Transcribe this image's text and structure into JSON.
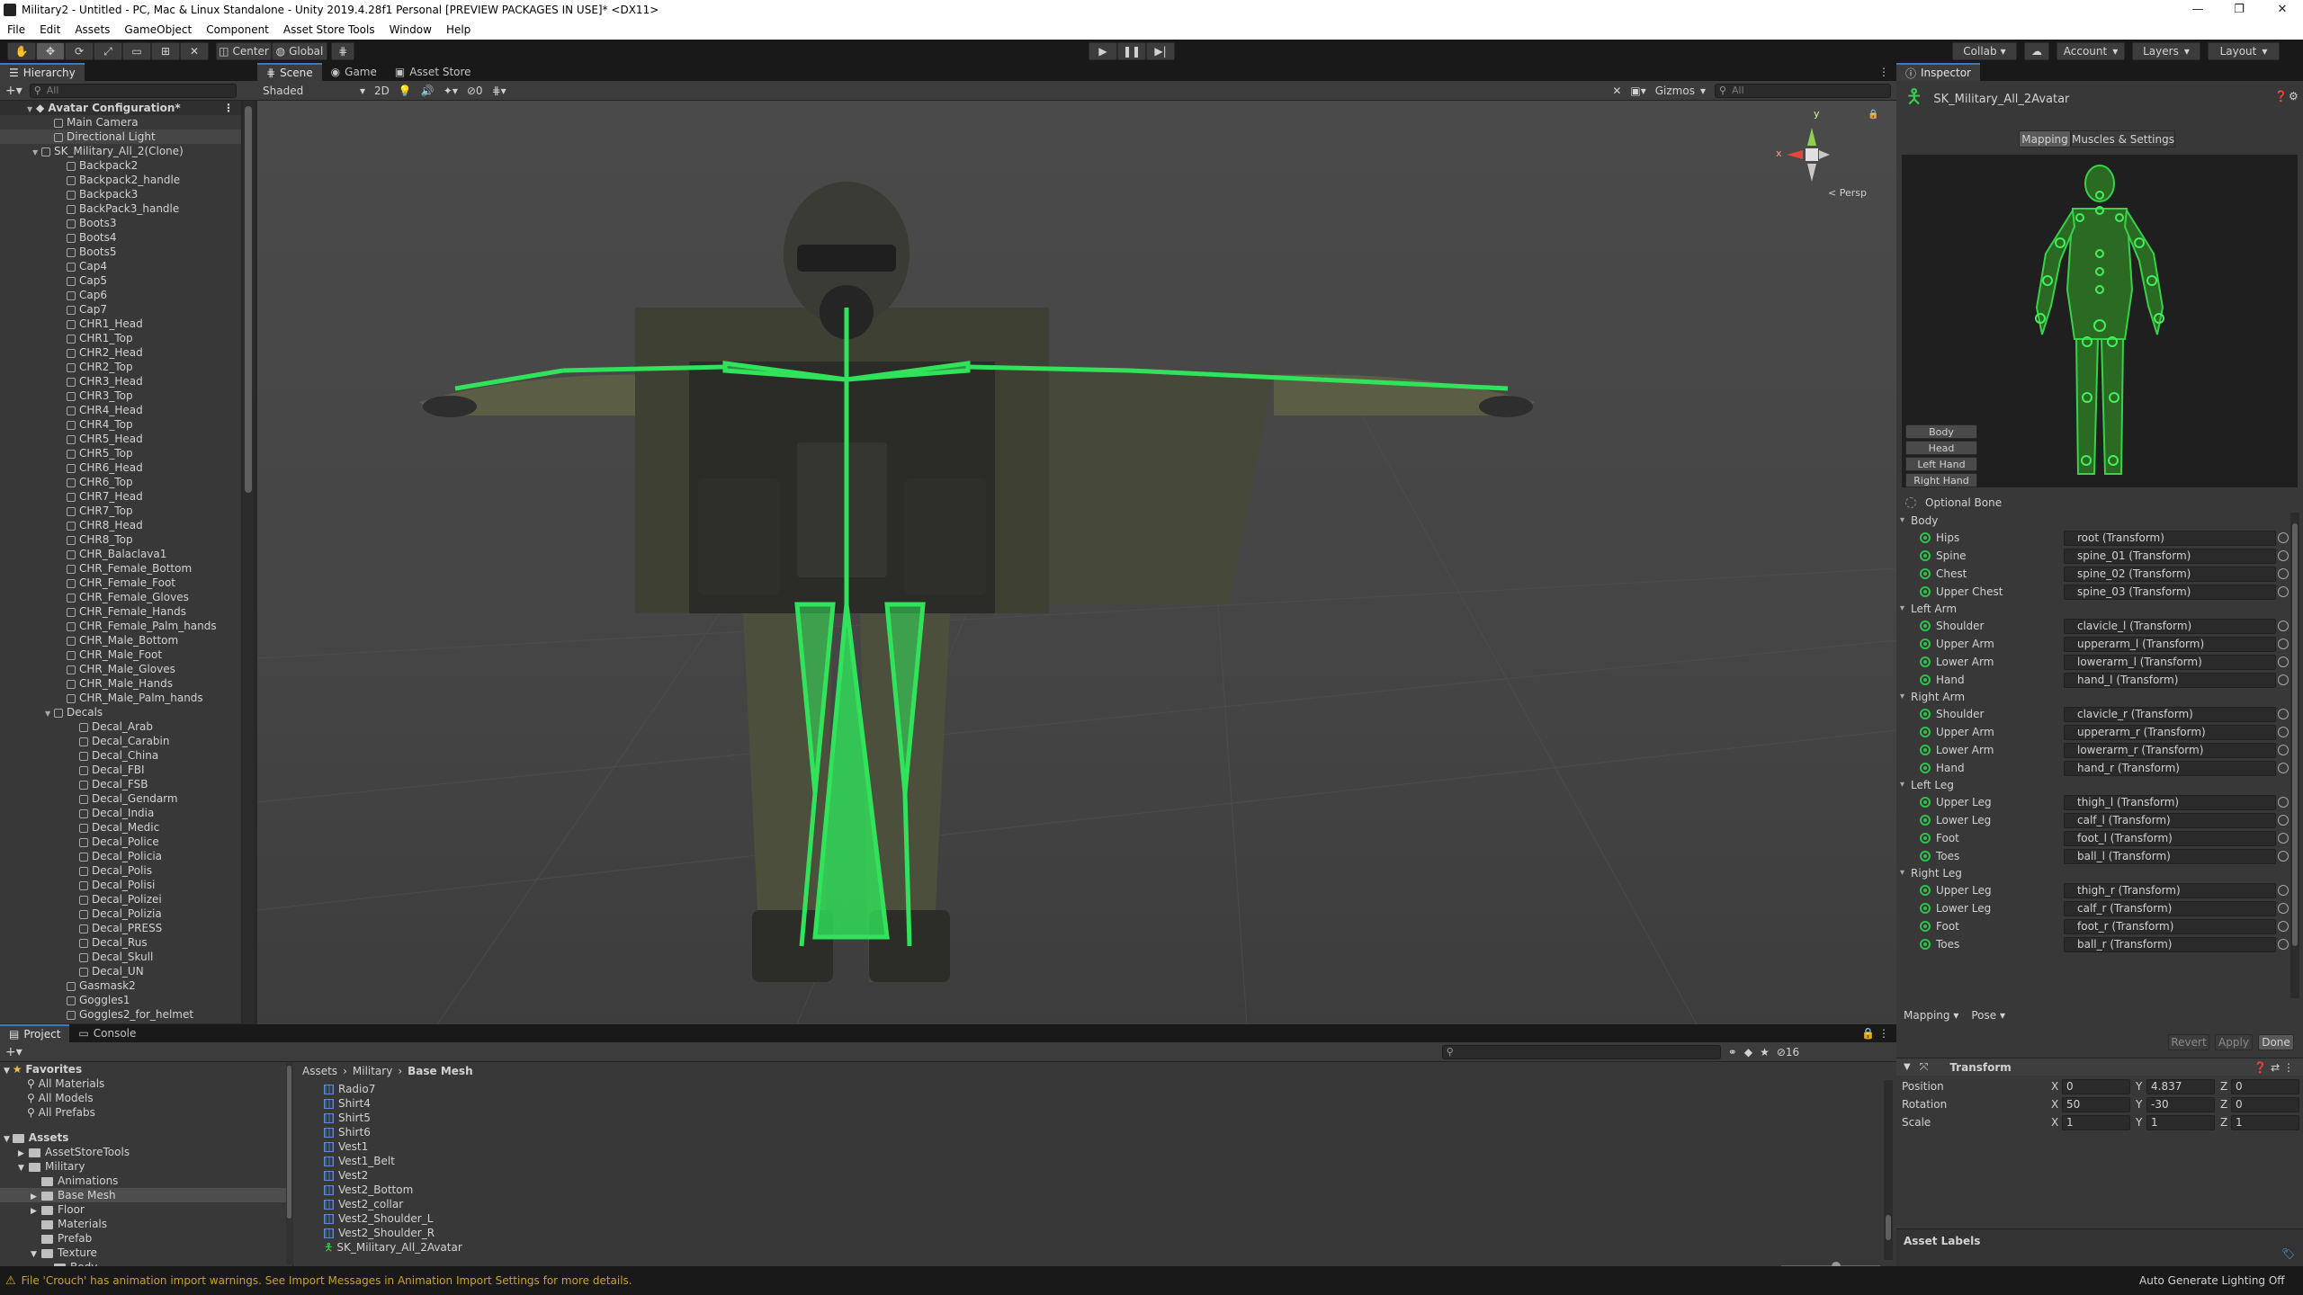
{
  "window": {
    "title": "Military2 - Untitled - PC, Mac & Linux Standalone - Unity 2019.4.28f1 Personal [PREVIEW PACKAGES IN USE]* <DX11>"
  },
  "menu": [
    "File",
    "Edit",
    "Assets",
    "GameObject",
    "Component",
    "Asset Store Tools",
    "Window",
    "Help"
  ],
  "toolbar": {
    "pivot_label": "Center",
    "space_label": "Global",
    "collab_label": "Collab",
    "account_label": "Account",
    "layers_label": "Layers",
    "layout_label": "Layout"
  },
  "hierarchy": {
    "tab": "Hierarchy",
    "search_placeholder": "All",
    "root": "Avatar Configuration*",
    "items": [
      {
        "label": "Main Camera",
        "indent": 3
      },
      {
        "label": "Directional Light",
        "indent": 3
      },
      {
        "label": "SK_Military_All_2(Clone)",
        "indent": 2,
        "arrow": true
      },
      {
        "label": "Backpack2",
        "indent": 4
      },
      {
        "label": "Backpack2_handle",
        "indent": 4
      },
      {
        "label": "Backpack3",
        "indent": 4
      },
      {
        "label": "BackPack3_handle",
        "indent": 4
      },
      {
        "label": "Boots3",
        "indent": 4
      },
      {
        "label": "Boots4",
        "indent": 4
      },
      {
        "label": "Boots5",
        "indent": 4
      },
      {
        "label": "Cap4",
        "indent": 4
      },
      {
        "label": "Cap5",
        "indent": 4
      },
      {
        "label": "Cap6",
        "indent": 4
      },
      {
        "label": "Cap7",
        "indent": 4
      },
      {
        "label": "CHR1_Head",
        "indent": 4
      },
      {
        "label": "CHR1_Top",
        "indent": 4
      },
      {
        "label": "CHR2_Head",
        "indent": 4
      },
      {
        "label": "CHR2_Top",
        "indent": 4
      },
      {
        "label": "CHR3_Head",
        "indent": 4
      },
      {
        "label": "CHR3_Top",
        "indent": 4
      },
      {
        "label": "CHR4_Head",
        "indent": 4
      },
      {
        "label": "CHR4_Top",
        "indent": 4
      },
      {
        "label": "CHR5_Head",
        "indent": 4
      },
      {
        "label": "CHR5_Top",
        "indent": 4
      },
      {
        "label": "CHR6_Head",
        "indent": 4
      },
      {
        "label": "CHR6_Top",
        "indent": 4
      },
      {
        "label": "CHR7_Head",
        "indent": 4
      },
      {
        "label": "CHR7_Top",
        "indent": 4
      },
      {
        "label": "CHR8_Head",
        "indent": 4
      },
      {
        "label": "CHR8_Top",
        "indent": 4
      },
      {
        "label": "CHR_Balaclava1",
        "indent": 4
      },
      {
        "label": "CHR_Female_Bottom",
        "indent": 4
      },
      {
        "label": "CHR_Female_Foot",
        "indent": 4
      },
      {
        "label": "CHR_Female_Gloves",
        "indent": 4
      },
      {
        "label": "CHR_Female_Hands",
        "indent": 4
      },
      {
        "label": "CHR_Female_Palm_hands",
        "indent": 4
      },
      {
        "label": "CHR_Male_Bottom",
        "indent": 4
      },
      {
        "label": "CHR_Male_Foot",
        "indent": 4
      },
      {
        "label": "CHR_Male_Gloves",
        "indent": 4
      },
      {
        "label": "CHR_Male_Hands",
        "indent": 4
      },
      {
        "label": "CHR_Male_Palm_hands",
        "indent": 4
      },
      {
        "label": "Decals",
        "indent": 3,
        "arrow": true
      },
      {
        "label": "Decal_Arab",
        "indent": 5
      },
      {
        "label": "Decal_Carabin",
        "indent": 5
      },
      {
        "label": "Decal_China",
        "indent": 5
      },
      {
        "label": "Decal_FBI",
        "indent": 5
      },
      {
        "label": "Decal_FSB",
        "indent": 5
      },
      {
        "label": "Decal_Gendarm",
        "indent": 5
      },
      {
        "label": "Decal_India",
        "indent": 5
      },
      {
        "label": "Decal_Medic",
        "indent": 5
      },
      {
        "label": "Decal_Police",
        "indent": 5
      },
      {
        "label": "Decal_Policia",
        "indent": 5
      },
      {
        "label": "Decal_Polis",
        "indent": 5
      },
      {
        "label": "Decal_Polisi",
        "indent": 5
      },
      {
        "label": "Decal_Polizei",
        "indent": 5
      },
      {
        "label": "Decal_Polizia",
        "indent": 5
      },
      {
        "label": "Decal_PRESS",
        "indent": 5
      },
      {
        "label": "Decal_Rus",
        "indent": 5
      },
      {
        "label": "Decal_Skull",
        "indent": 5
      },
      {
        "label": "Decal_UN",
        "indent": 5
      },
      {
        "label": "Gasmask2",
        "indent": 4
      },
      {
        "label": "Goggles1",
        "indent": 4
      },
      {
        "label": "Goggles2_for_helmet",
        "indent": 4
      }
    ]
  },
  "scene": {
    "tabs": [
      "Scene",
      "Game",
      "Asset Store"
    ],
    "shading": "Shaded",
    "mode_2d": "2D",
    "hidden_count": "0",
    "gizmos": "Gizmos",
    "search_placeholder": "All",
    "persp_label": "< Persp",
    "axis_y": "y",
    "axis_x": "x"
  },
  "inspector": {
    "tab": "Inspector",
    "object_name": "SK_Military_All_2Avatar",
    "tab_mapping": "Mapping",
    "tab_muscles": "Muscles & Settings",
    "body_buttons": [
      "Body",
      "Head",
      "Left Hand",
      "Right Hand"
    ],
    "optional_bone": "Optional Bone",
    "groups": [
      {
        "name": "Body",
        "bones": [
          {
            "name": "Hips",
            "value": "root (Transform)"
          },
          {
            "name": "Spine",
            "value": "spine_01 (Transform)"
          },
          {
            "name": "Chest",
            "value": "spine_02 (Transform)"
          },
          {
            "name": "Upper Chest",
            "value": "spine_03 (Transform)"
          }
        ]
      },
      {
        "name": "Left Arm",
        "bones": [
          {
            "name": "Shoulder",
            "value": "clavicle_l (Transform)"
          },
          {
            "name": "Upper Arm",
            "value": "upperarm_l (Transform)"
          },
          {
            "name": "Lower Arm",
            "value": "lowerarm_l (Transform)"
          },
          {
            "name": "Hand",
            "value": "hand_l (Transform)"
          }
        ]
      },
      {
        "name": "Right Arm",
        "bones": [
          {
            "name": "Shoulder",
            "value": "clavicle_r (Transform)"
          },
          {
            "name": "Upper Arm",
            "value": "upperarm_r (Transform)"
          },
          {
            "name": "Lower Arm",
            "value": "lowerarm_r (Transform)"
          },
          {
            "name": "Hand",
            "value": "hand_r (Transform)"
          }
        ]
      },
      {
        "name": "Left Leg",
        "bones": [
          {
            "name": "Upper Leg",
            "value": "thigh_l (Transform)"
          },
          {
            "name": "Lower Leg",
            "value": "calf_l (Transform)"
          },
          {
            "name": "Foot",
            "value": "foot_l (Transform)"
          },
          {
            "name": "Toes",
            "value": "ball_l (Transform)"
          }
        ]
      },
      {
        "name": "Right Leg",
        "bones": [
          {
            "name": "Upper Leg",
            "value": "thigh_r (Transform)"
          },
          {
            "name": "Lower Leg",
            "value": "calf_r (Transform)"
          },
          {
            "name": "Foot",
            "value": "foot_r (Transform)"
          },
          {
            "name": "Toes",
            "value": "ball_r (Transform)"
          }
        ]
      }
    ],
    "mapping_dropdown": "Mapping",
    "pose_dropdown": "Pose",
    "revert": "Revert",
    "apply": "Apply",
    "done": "Done",
    "transform_title": "Transform",
    "position_label": "Position",
    "rotation_label": "Rotation",
    "scale_label": "Scale",
    "position": {
      "x": "0",
      "y": "4.837",
      "z": "0"
    },
    "rotation": {
      "x": "50",
      "y": "-30",
      "z": "0"
    },
    "scale": {
      "x": "1",
      "y": "1",
      "z": "1"
    },
    "asset_labels": "Asset Labels"
  },
  "project": {
    "tabs": [
      "Project",
      "Console"
    ],
    "favorites_label": "Favorites",
    "favorites": [
      "All Materials",
      "All Models",
      "All Prefabs"
    ],
    "assets_label": "Assets",
    "tree": [
      {
        "label": "AssetStoreTools",
        "indent": 1,
        "arrow": "▸"
      },
      {
        "label": "Military",
        "indent": 1,
        "arrow": "▾"
      },
      {
        "label": "Animations",
        "indent": 2,
        "arrow": ""
      },
      {
        "label": "Base Mesh",
        "indent": 2,
        "arrow": "▸",
        "selected": true
      },
      {
        "label": "Floor",
        "indent": 2,
        "arrow": "▸"
      },
      {
        "label": "Materials",
        "indent": 2,
        "arrow": ""
      },
      {
        "label": "Prefab",
        "indent": 2,
        "arrow": ""
      },
      {
        "label": "Texture",
        "indent": 2,
        "arrow": "▾"
      },
      {
        "label": "Body",
        "indent": 3,
        "arrow": ""
      }
    ],
    "breadcrumb": [
      "Assets",
      "Military",
      "Base Mesh"
    ],
    "files": [
      "Radio7",
      "Shirt4",
      "Shirt5",
      "Shirt6",
      "Vest1",
      "Vest1_Belt",
      "Vest2",
      "Vest2_Bottom",
      "Vest2_collar",
      "Vest2_Shoulder_L",
      "Vest2_Shoulder_R",
      "SK_Military_All_2Avatar"
    ],
    "hidden_count": "16"
  },
  "status": {
    "warning": "File 'Crouch' has animation import warnings. See Import Messages in Animation Import Settings for more details.",
    "lighting": "Auto Generate Lighting Off"
  },
  "colors": {
    "accent": "#3a79bb",
    "bone_green": "#2ec24a",
    "warning_yellow": "#e0b000"
  }
}
